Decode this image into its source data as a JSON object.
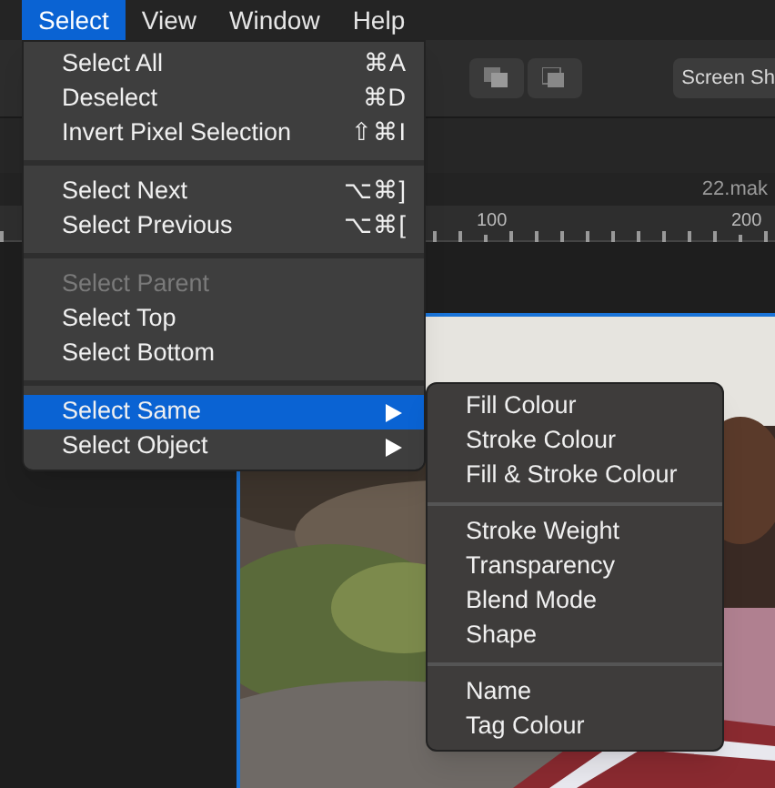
{
  "menu_bar": [
    {
      "label": "Select",
      "selected": true
    },
    {
      "label": "View",
      "selected": false
    },
    {
      "label": "Window",
      "selected": false
    },
    {
      "label": "Help",
      "selected": false
    }
  ],
  "toolbar": {
    "button": "Screen Sh"
  },
  "document_tab": "22.mak",
  "ruler": [
    "100",
    "200"
  ],
  "menu": [
    [
      {
        "label": "Select All",
        "shortcut": "⌘A",
        "disabled": false,
        "selected": false,
        "submenu": false
      },
      {
        "label": "Deselect",
        "shortcut": "⌘D",
        "disabled": false,
        "selected": false,
        "submenu": false
      },
      {
        "label": "Invert Pixel Selection",
        "shortcut": "⇧⌘I",
        "disabled": false,
        "selected": false,
        "submenu": false
      }
    ],
    [
      {
        "label": "Select Next",
        "shortcut": "⌥⌘]",
        "disabled": false,
        "selected": false,
        "submenu": false
      },
      {
        "label": "Select Previous",
        "shortcut": "⌥⌘[",
        "disabled": false,
        "selected": false,
        "submenu": false
      }
    ],
    [
      {
        "label": "Select Parent",
        "disabled": true,
        "selected": false,
        "submenu": false
      },
      {
        "label": "Select Top",
        "disabled": false,
        "selected": false,
        "submenu": false
      },
      {
        "label": "Select Bottom",
        "disabled": false,
        "selected": false,
        "submenu": false
      }
    ],
    [
      {
        "label": "Select Same",
        "disabled": false,
        "selected": true,
        "submenu": true
      },
      {
        "label": "Select Object",
        "disabled": false,
        "selected": false,
        "submenu": true
      }
    ]
  ],
  "submenu": [
    [
      "Fill Colour",
      "Stroke Colour",
      "Fill & Stroke Colour"
    ],
    [
      "Stroke Weight",
      "Transparency",
      "Blend Mode",
      "Shape"
    ],
    [
      "Name",
      "Tag Colour"
    ]
  ]
}
